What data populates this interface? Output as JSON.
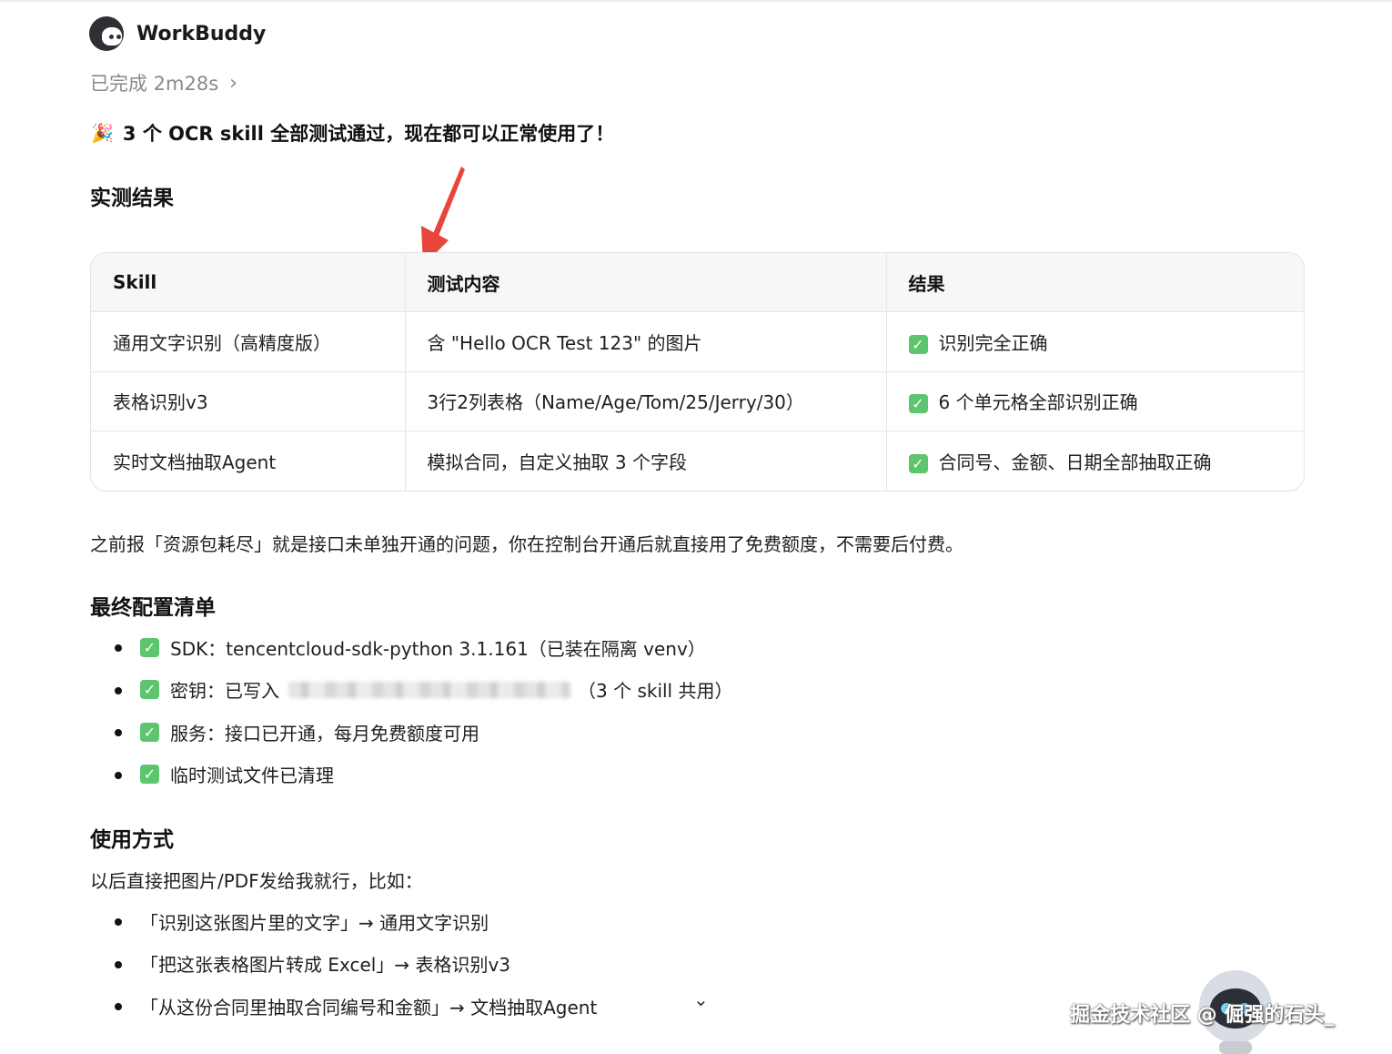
{
  "app": {
    "name": "WorkBuddy"
  },
  "status": {
    "text": "已完成 2m28s"
  },
  "headline": "3 个 OCR skill 全部测试通过，现在都可以正常使用了！",
  "results_heading": "实测结果",
  "table": {
    "headers": [
      "Skill",
      "测试内容",
      "结果"
    ],
    "rows": [
      [
        "通用文字识别（高精度版）",
        "含 \"Hello OCR Test 123\" 的图片",
        "识别完全正确"
      ],
      [
        "表格识别v3",
        "3行2列表格（Name/Age/Tom/25/Jerry/30）",
        "6 个单元格全部识别正确"
      ],
      [
        "实时文档抽取Agent",
        "模拟合同，自定义抽取 3 个字段",
        "合同号、金额、日期全部抽取正确"
      ]
    ]
  },
  "note": "之前报「资源包耗尽」就是接口未单独开通的问题，你在控制台开通后就直接用了免费额度，不需要后付费。",
  "config_heading": "最终配置清单",
  "config_items": [
    {
      "text": "SDK：tencentcloud-sdk-python 3.1.161（已装在隔离 venv）"
    },
    {
      "prefix": "密钥：已写入",
      "suffix": "（3 个 skill 共用）"
    },
    {
      "text": "服务：接口已开通，每月免费额度可用"
    },
    {
      "text": "临时测试文件已清理"
    }
  ],
  "usage_heading": "使用方式",
  "usage_intro": "以后直接把图片/PDF发给我就行，比如：",
  "usage_items": [
    "「识别这张图片里的文字」→ 通用文字识别",
    "「把这张表格图片转成 Excel」→ 表格识别v3",
    "「从这份合同里抽取合同编号和金额」→ 文档抽取Agent"
  ],
  "watermark": "掘金技术社区 @ 倔强的石头_",
  "colors": {
    "check": "#5cc56e",
    "arrow": "#e8453c",
    "muted": "#8a8a8a"
  }
}
